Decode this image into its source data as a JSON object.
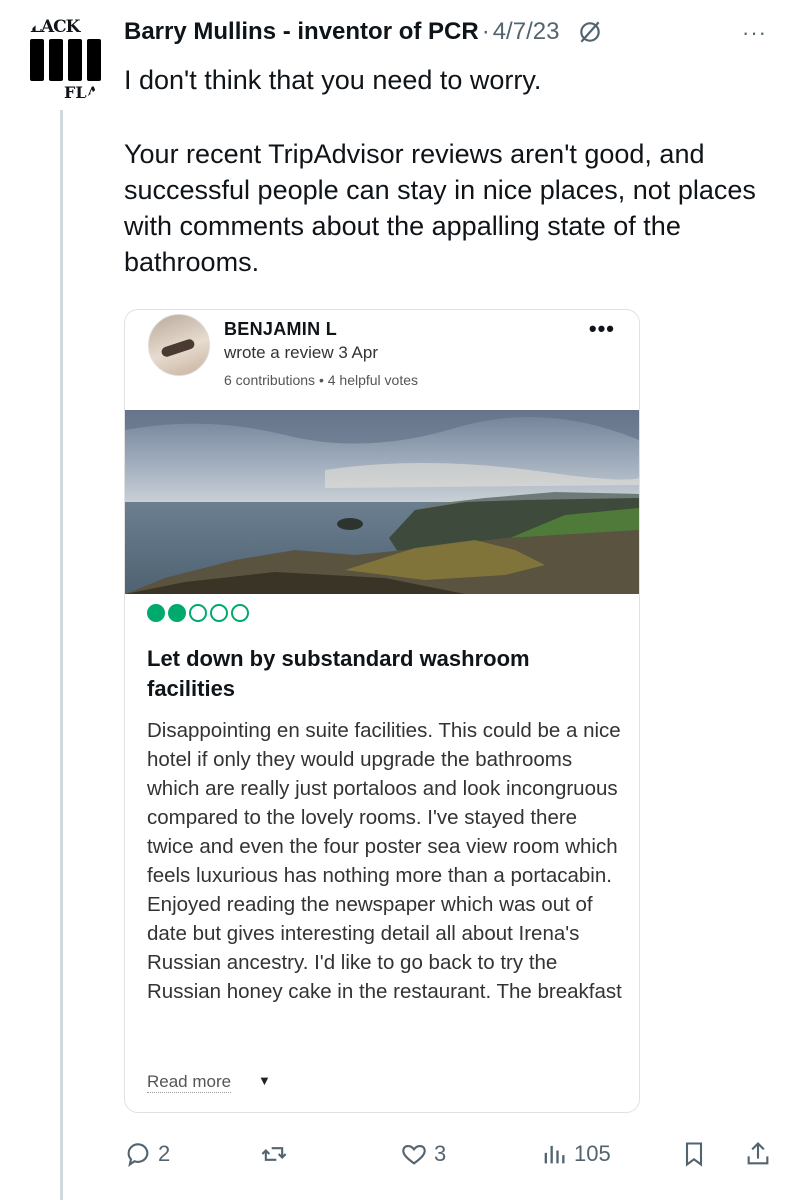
{
  "author": {
    "name": "Barry Mullins - inventor of PCR",
    "date": "4/7/23",
    "avatar_text_top": "LACK",
    "avatar_text_bottom": "FLA"
  },
  "tweet": {
    "paragraphs": [
      "I don't think that you need to worry.",
      "Your recent TripAdvisor reviews aren't good, and successful people can stay in nice places, not places with comments about the appalling state of the bathrooms."
    ]
  },
  "review_card": {
    "reviewer": "BENJAMIN L",
    "meta": "wrote a review 3 Apr",
    "contributions": "6 contributions • 4 helpful votes",
    "rating": 2,
    "rating_max": 5,
    "rating_color": "#00aa6c",
    "title": "Let down by substandard washroom facilities",
    "body": "Disappointing en suite facilities. This could be a nice hotel if only they would upgrade the bathrooms which are really just portaloos and look incongruous compared to the lovely rooms. I've stayed there twice and even the four poster sea view room which feels luxurious has nothing more than a portacabin. Enjoyed reading the newspaper which was out of date but gives interesting detail all about Irena's Russian ancestry. I'd like to go back to try the Russian honey cake in the restaurant. The breakfast",
    "read_more": "Read more"
  },
  "actions": {
    "replies": "2",
    "likes": "3",
    "views": "105"
  },
  "icons": [
    "grok-icon",
    "more-icon",
    "reply-icon",
    "retweet-icon",
    "like-icon",
    "views-icon",
    "bookmark-icon",
    "share-icon"
  ]
}
